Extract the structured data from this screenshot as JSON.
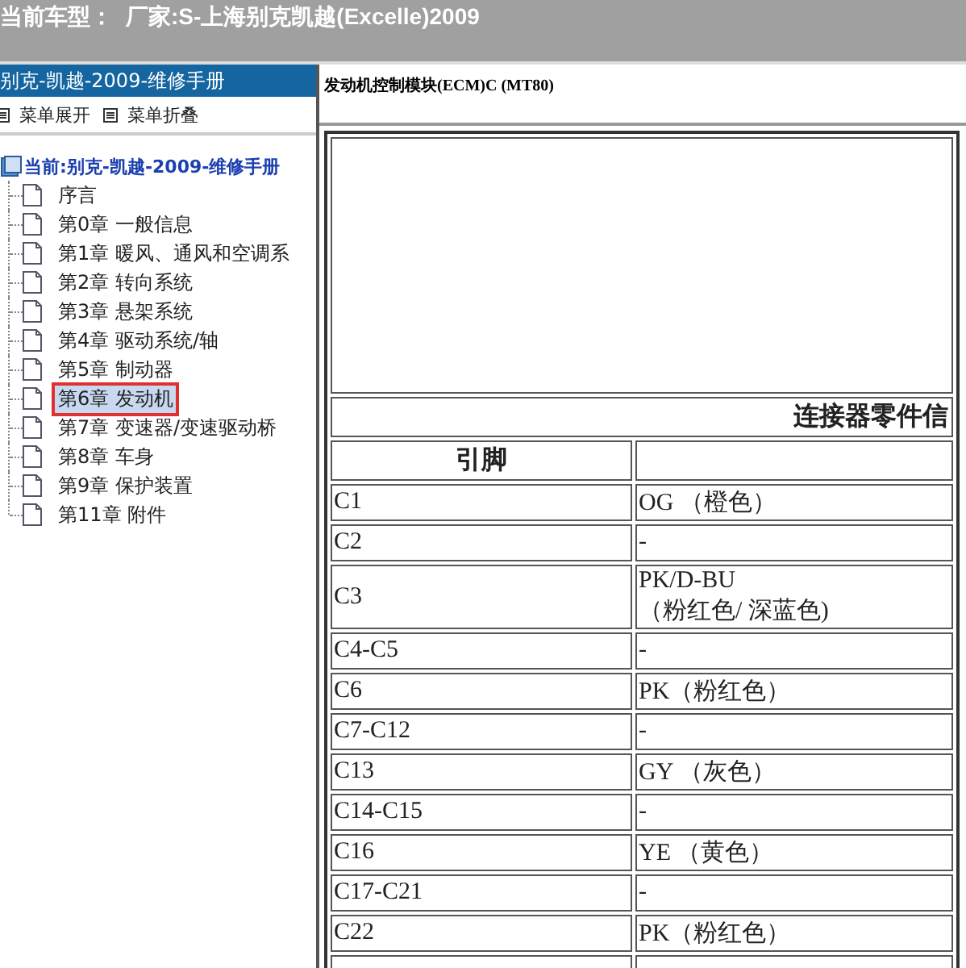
{
  "top_bar": {
    "label": "当前车型：",
    "value": "厂家:S-上海别克凯越(Excelle)2009"
  },
  "sidebar": {
    "title": "别克-凯越-2009-维修手册",
    "toolbar": [
      "菜单展开",
      "菜单折叠"
    ],
    "tree": {
      "label": "当前:别克-凯越-2009-维修手册",
      "children": [
        {
          "label": "序言",
          "selected": false
        },
        {
          "label": "第0章 一般信息",
          "selected": false
        },
        {
          "label": "第1章 暖风、通风和空调系",
          "selected": false
        },
        {
          "label": "第2章 转向系统",
          "selected": false
        },
        {
          "label": "第3章 悬架系统",
          "selected": false
        },
        {
          "label": "第4章 驱动系统/轴",
          "selected": false
        },
        {
          "label": "第5章 制动器",
          "selected": false
        },
        {
          "label": "第6章 发动机",
          "selected": true
        },
        {
          "label": "第7章 变速器/变速驱动桥",
          "selected": false
        },
        {
          "label": "第8章 车身",
          "selected": false
        },
        {
          "label": "第9章 保护装置",
          "selected": false
        },
        {
          "label": "第11章 附件",
          "selected": false
        }
      ]
    }
  },
  "content": {
    "title": "发动机控制模块(ECM)C (MT80)",
    "table": {
      "caption": "连接器零件信",
      "columns": [
        "引脚"
      ],
      "rows": [
        {
          "pin": "C1",
          "wire": [
            "OG （橙色）"
          ]
        },
        {
          "pin": "C2",
          "wire": [
            "-"
          ]
        },
        {
          "pin": "C3",
          "wire": [
            "PK/D-BU",
            "（粉红色/ 深蓝色)"
          ]
        },
        {
          "pin": "C4-C5",
          "wire": [
            "-"
          ]
        },
        {
          "pin": "C6",
          "wire": [
            "PK（粉红色）"
          ]
        },
        {
          "pin": "C7-C12",
          "wire": [
            "-"
          ]
        },
        {
          "pin": "C13",
          "wire": [
            "GY （灰色）"
          ]
        },
        {
          "pin": "C14-C15",
          "wire": [
            "-"
          ]
        },
        {
          "pin": "C16",
          "wire": [
            "YE （黄色）"
          ]
        },
        {
          "pin": "C17-C21",
          "wire": [
            "-"
          ]
        },
        {
          "pin": "C22",
          "wire": [
            "PK（粉红色）"
          ]
        }
      ]
    }
  }
}
